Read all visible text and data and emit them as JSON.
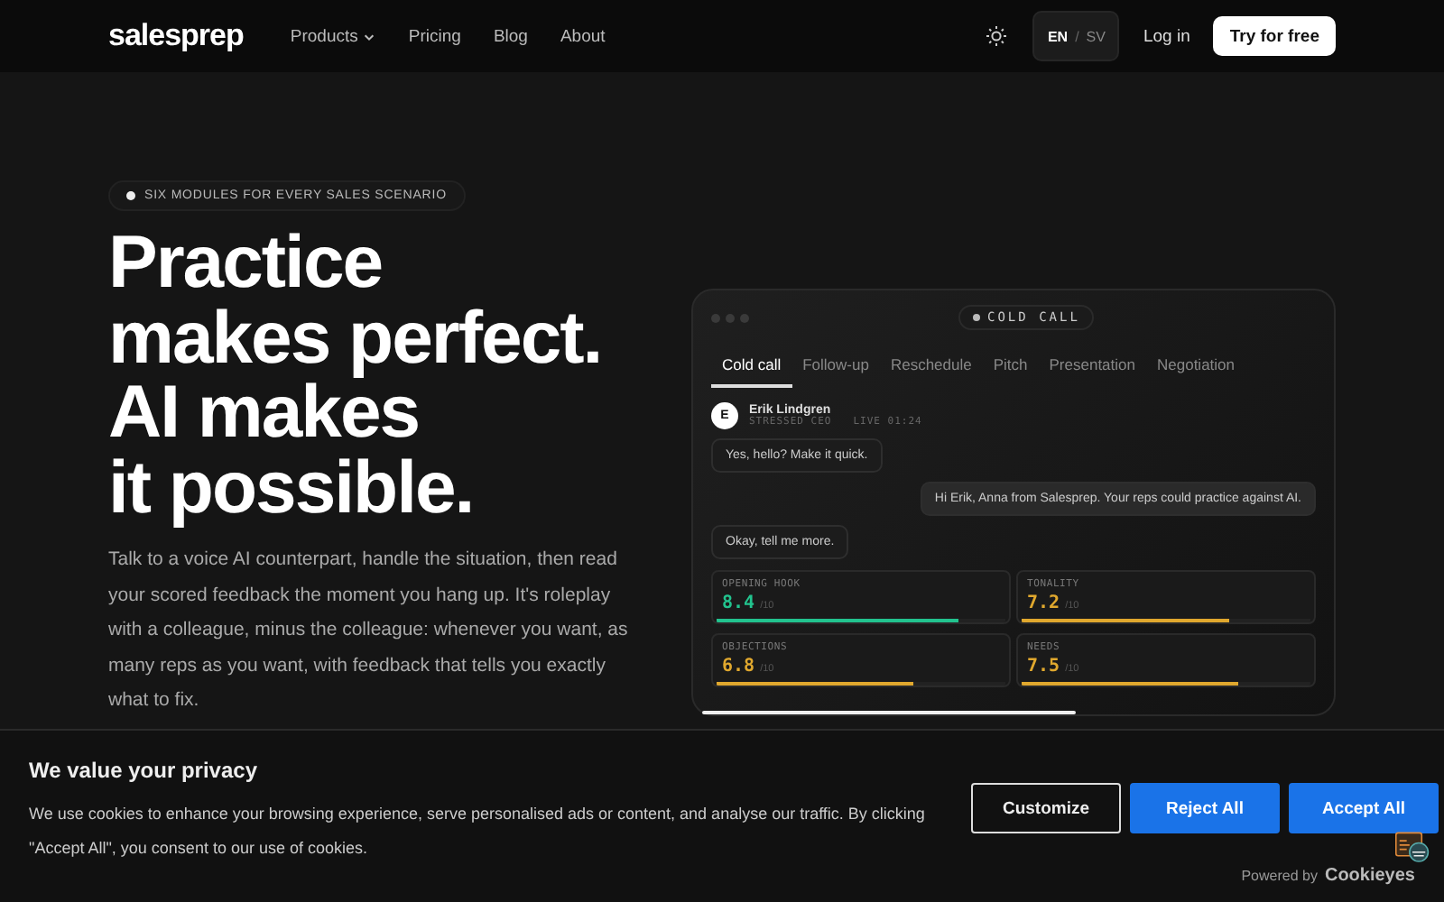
{
  "nav": {
    "logo": "salesprep",
    "links": [
      {
        "label": "Products",
        "dropdown": true
      },
      {
        "label": "Pricing",
        "dropdown": false
      },
      {
        "label": "Blog",
        "dropdown": false
      },
      {
        "label": "About",
        "dropdown": false
      }
    ],
    "languages": [
      {
        "label": "EN",
        "selected": true
      },
      {
        "label": "SV",
        "selected": false
      }
    ],
    "lang_separator": "/",
    "login": "Log in",
    "cta": "Try for free"
  },
  "hero": {
    "badge": "SIX MODULES FOR EVERY SALES SCENARIO",
    "headline": [
      "Practice",
      "makes perfect.",
      "AI makes",
      "it possible."
    ],
    "text": "Talk to a voice AI counterpart, handle the situation, then read your scored feedback the moment you hang up. It's roleplay with a colleague, minus the colleague: whenever you want, as many reps as you want, with feedback that tells you exactly what to fix."
  },
  "demo": {
    "pill": "COLD CALL",
    "tabs": [
      {
        "label": "Cold call",
        "selected": true
      },
      {
        "label": "Follow-up",
        "selected": false
      },
      {
        "label": "Reschedule",
        "selected": false
      },
      {
        "label": "Pitch",
        "selected": false
      },
      {
        "label": "Presentation",
        "selected": false
      },
      {
        "label": "Negotiation",
        "selected": false
      }
    ],
    "contact": {
      "initial": "E",
      "name": "Erik Lindgren",
      "role": "STRESSED CEO",
      "status": "LIVE 01:24"
    },
    "messages": [
      {
        "text": "Yes, hello? Make it quick.",
        "kind": "incoming"
      },
      {
        "text": "Hi Erik, Anna from Salesprep. Your reps could practice against AI.",
        "kind": "outgoing"
      },
      {
        "text": "Okay, tell me more.",
        "kind": "incoming"
      }
    ],
    "scores": [
      {
        "label": "OPENING HOOK",
        "value": "8.4",
        "max": "/10",
        "level": 0.84,
        "color": "#22c38e"
      },
      {
        "label": "TONALITY",
        "value": "7.2",
        "max": "/10",
        "level": 0.72,
        "color": "#e0a82e"
      },
      {
        "label": "OBJECTIONS",
        "value": "6.8",
        "max": "/10",
        "level": 0.68,
        "color": "#e0a82e"
      },
      {
        "label": "NEEDS",
        "value": "7.5",
        "max": "/10",
        "level": 0.75,
        "color": "#e0a82e"
      }
    ],
    "progress": {
      "level": 0.6
    }
  },
  "cookie_banner": {
    "title": "We value your privacy",
    "text": "We use cookies to enhance your browsing experience, serve personalised ads or content, and analyse our traffic. By clicking \"Accept All\", you consent to our use of cookies.",
    "buttons": [
      {
        "label": "Customize",
        "kind": "outline"
      },
      {
        "label": "Reject All",
        "kind": "solid"
      },
      {
        "label": "Accept All",
        "kind": "solid"
      }
    ],
    "powered_by": "Powered by",
    "brand": "Cookieyes"
  }
}
